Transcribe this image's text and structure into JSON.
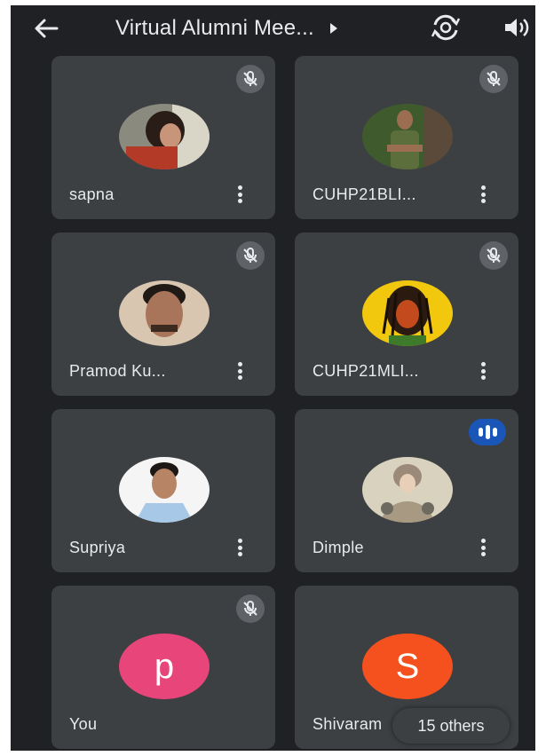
{
  "header": {
    "title": "Virtual Alumni Mee...",
    "back_icon": "arrow-left-icon",
    "camera_icon": "switch-camera-icon",
    "speaker_icon": "speaker-icon"
  },
  "participants": [
    {
      "name": "sapna",
      "avatar": "photo",
      "mic": "muted"
    },
    {
      "name": "CUHP21BLI...",
      "avatar": "photo",
      "mic": "muted"
    },
    {
      "name": "Pramod Ku...",
      "avatar": "photo",
      "mic": "muted"
    },
    {
      "name": "CUHP21MLI...",
      "avatar": "photo",
      "mic": "muted"
    },
    {
      "name": "Supriya",
      "avatar": "photo",
      "mic": "none"
    },
    {
      "name": "Dimple",
      "avatar": "photo",
      "mic": "speaking"
    },
    {
      "name": "You",
      "avatar": "letter",
      "initial": "p",
      "avatar_color": "#e8457a",
      "mic": "muted"
    },
    {
      "name": "Shivaram",
      "avatar": "letter",
      "initial": "S",
      "avatar_color": "#f4511e",
      "mic": "none"
    }
  ],
  "others_chip": "15 others",
  "colors": {
    "background": "#202124",
    "tile": "#3c4043",
    "mute_badge": "#5f6368",
    "speaking_badge": "#1a56b8"
  }
}
